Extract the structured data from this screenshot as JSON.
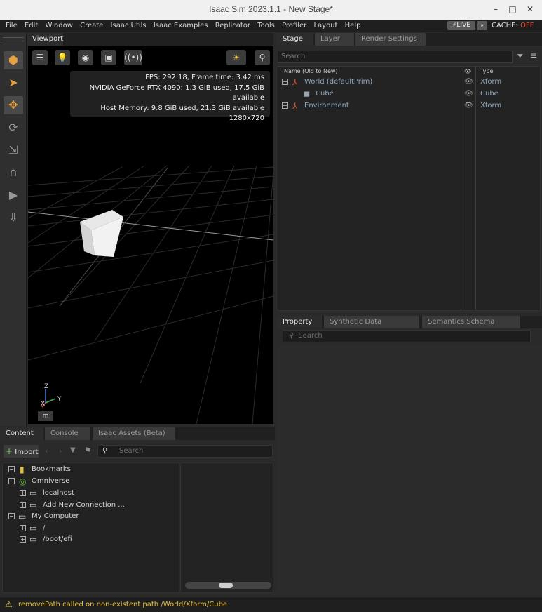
{
  "window": {
    "title": "Isaac Sim 2023.1.1 - New Stage*",
    "minimize": "–",
    "maximize": "□",
    "close": "✕"
  },
  "menu": {
    "items": [
      "File",
      "Edit",
      "Window",
      "Create",
      "Isaac Utils",
      "Isaac Examples",
      "Replicator",
      "Tools",
      "Profiler",
      "Layout",
      "Help"
    ]
  },
  "live": {
    "label": "LIVE",
    "cache_label": "CACHE:",
    "cache_state": "OFF"
  },
  "viewport": {
    "tab": "Viewport",
    "stats": [
      "FPS: 292.18, Frame time: 3.42 ms",
      "NVIDIA GeForce RTX 4090: 1.3 GiB used, 17.5 GiB available",
      "Host Memory: 9.8 GiB used, 21.3 GiB available",
      "1280x720"
    ],
    "axis": {
      "z": "Z",
      "y": "Y",
      "x": "X"
    },
    "unit_badge": "m"
  },
  "stage": {
    "tabs": [
      "Stage",
      "Layer",
      "Render Settings"
    ],
    "search_placeholder": "Search",
    "col_name": "Name (Old to New)",
    "col_type": "Type",
    "rows": [
      {
        "name": "World (defaultPrim)",
        "type": "Xform"
      },
      {
        "name": "Cube",
        "type": "Cube"
      },
      {
        "name": "Environment",
        "type": "Xform"
      }
    ]
  },
  "property": {
    "tabs": [
      "Property",
      "Synthetic Data Recorder",
      "Semantics Schema Editor"
    ],
    "search_placeholder": "Search"
  },
  "content": {
    "tabs": [
      "Content",
      "Console",
      "Isaac Assets (Beta)"
    ],
    "import_label": "Import",
    "search_placeholder": "Search",
    "tree": [
      {
        "label": "Bookmarks"
      },
      {
        "label": "Omniverse"
      },
      {
        "label": "localhost"
      },
      {
        "label": "Add New Connection ..."
      },
      {
        "label": "My Computer"
      },
      {
        "label": "/"
      },
      {
        "label": "/boot/efi"
      }
    ]
  },
  "status": {
    "message": "removePath called on non-existent path /World/Xform/Cube"
  }
}
